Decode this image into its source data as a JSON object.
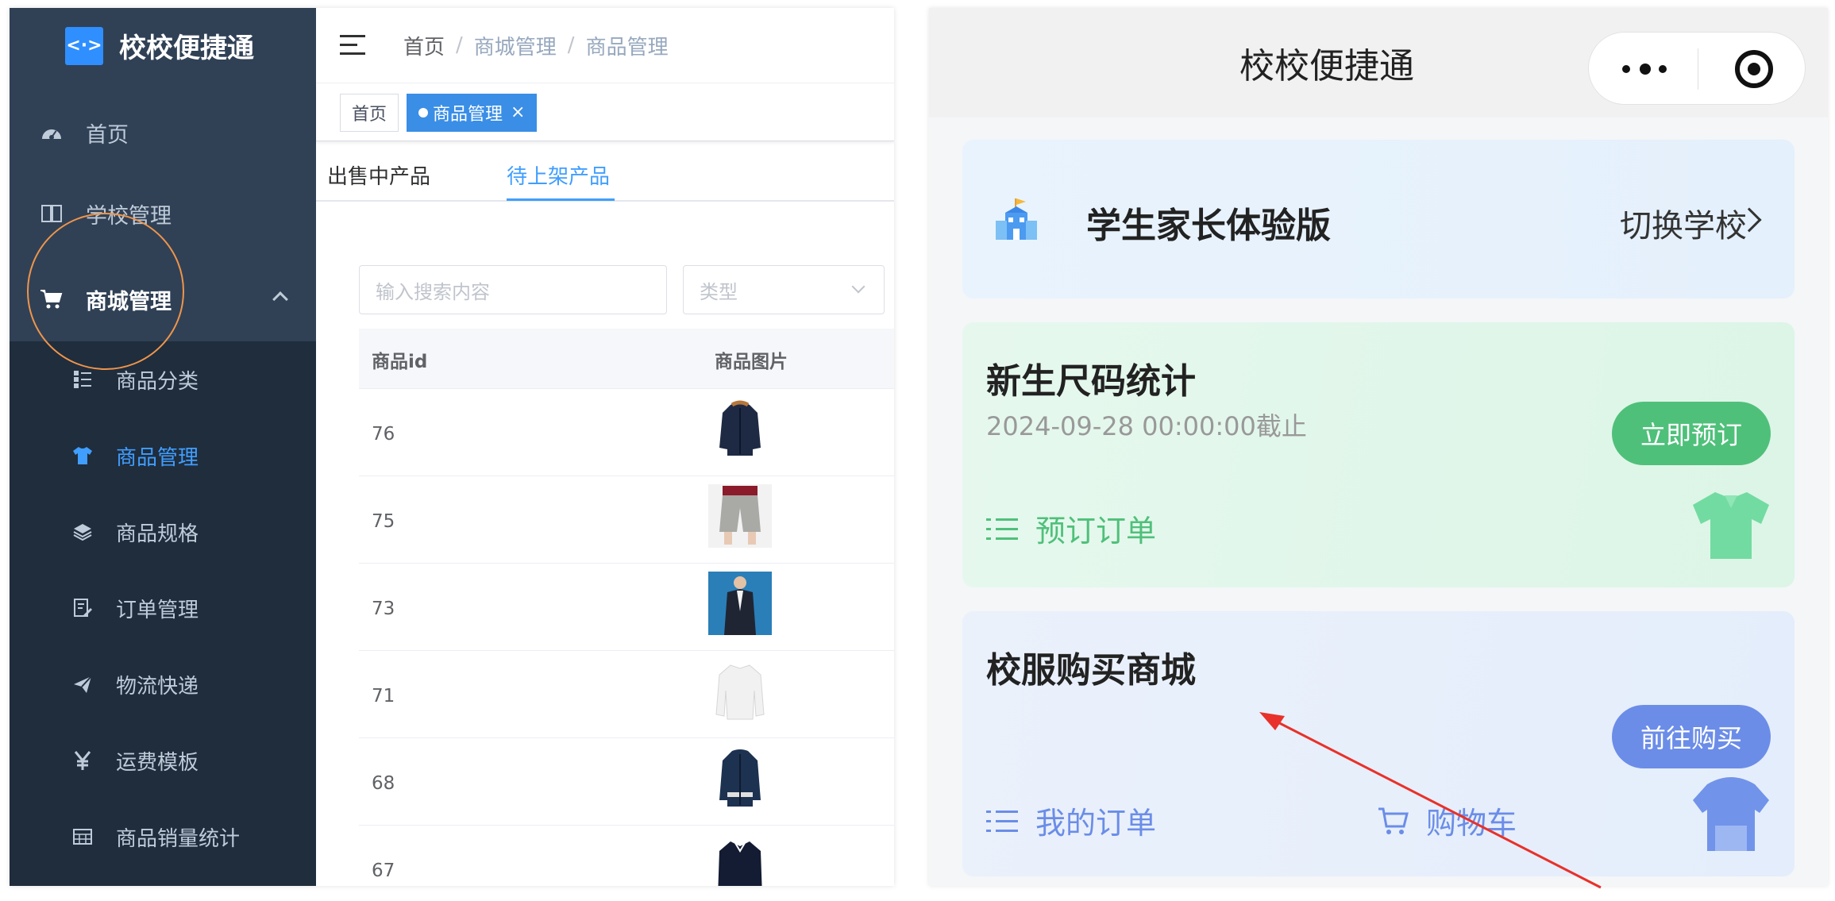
{
  "admin": {
    "logo": {
      "mark": "<·>",
      "title": "校校便捷通"
    },
    "menu": [
      {
        "label": "首页",
        "icon": "dashboard-icon"
      },
      {
        "label": "学校管理",
        "icon": "book-icon"
      },
      {
        "label": "商城管理",
        "icon": "cart-icon"
      }
    ],
    "submenu": [
      {
        "label": "商品分类",
        "icon": "category-icon"
      },
      {
        "label": "商品管理",
        "icon": "shirt-icon",
        "active": true
      },
      {
        "label": "商品规格",
        "icon": "layers-icon"
      },
      {
        "label": "订单管理",
        "icon": "order-edit-icon"
      },
      {
        "label": "物流快递",
        "icon": "paper-plane-icon"
      },
      {
        "label": "运费模板",
        "icon": "yen-icon"
      },
      {
        "label": "商品销量统计",
        "icon": "table-grid-icon"
      }
    ],
    "breadcrumb": [
      "首页",
      "商城管理",
      "商品管理"
    ],
    "breadcrumb_sep": "/",
    "tags": {
      "home": "首页",
      "active": "商品管理",
      "close": "×"
    },
    "tabs": {
      "selling": "出售中产品",
      "pending": "待上架产品"
    },
    "search": {
      "placeholder": "输入搜索内容",
      "type_placeholder": "类型"
    },
    "table": {
      "headers": {
        "id": "商品id",
        "image": "商品图片"
      },
      "rows": [
        {
          "id": "76",
          "thumb": "navy-parka"
        },
        {
          "id": "75",
          "thumb": "grey-shorts"
        },
        {
          "id": "73",
          "thumb": "dark-blazer"
        },
        {
          "id": "71",
          "thumb": "white-shirt"
        },
        {
          "id": "68",
          "thumb": "navy-jacket"
        },
        {
          "id": "67",
          "thumb": "navy-polo"
        }
      ]
    }
  },
  "mini": {
    "title": "校校便捷通",
    "school_card": {
      "title": "学生家长体验版",
      "switch": "切换学校"
    },
    "size_card": {
      "title": "新生尺码统计",
      "deadline": "2024-09-28 00:00:00截止",
      "button": "立即预订",
      "link": "预订订单"
    },
    "shop_card": {
      "title": "校服购买商城",
      "button": "前往购买",
      "link_orders": "我的订单",
      "link_cart": "购物车"
    },
    "colors": {
      "green": "#4fc07a",
      "blue": "#6b8de8",
      "sidebar": "#304156",
      "active_blue": "#409eff"
    }
  }
}
